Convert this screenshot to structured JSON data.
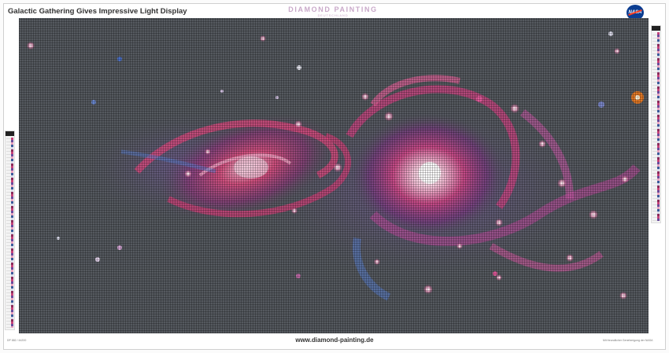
{
  "header": {
    "title": "Galactic Gathering Gives Impressive Light Display",
    "brand": "DIAMOND PAINTING",
    "brand_sub": "DEUTSCHLAND",
    "partner_logo": "NASA"
  },
  "footer": {
    "left": "DP 882 / 44200",
    "center": "www.diamond-painting.de",
    "right": "Mit freundlicher Genehmigung der NASA"
  },
  "colors": {
    "canvas_background": "#55595f",
    "galaxy_magenta": "#d43a78",
    "galaxy_violet": "#8a5bb0",
    "core_white": "#fff1f6",
    "star_blue": "#4a6fc8",
    "star_orange": "#f07a1f"
  }
}
